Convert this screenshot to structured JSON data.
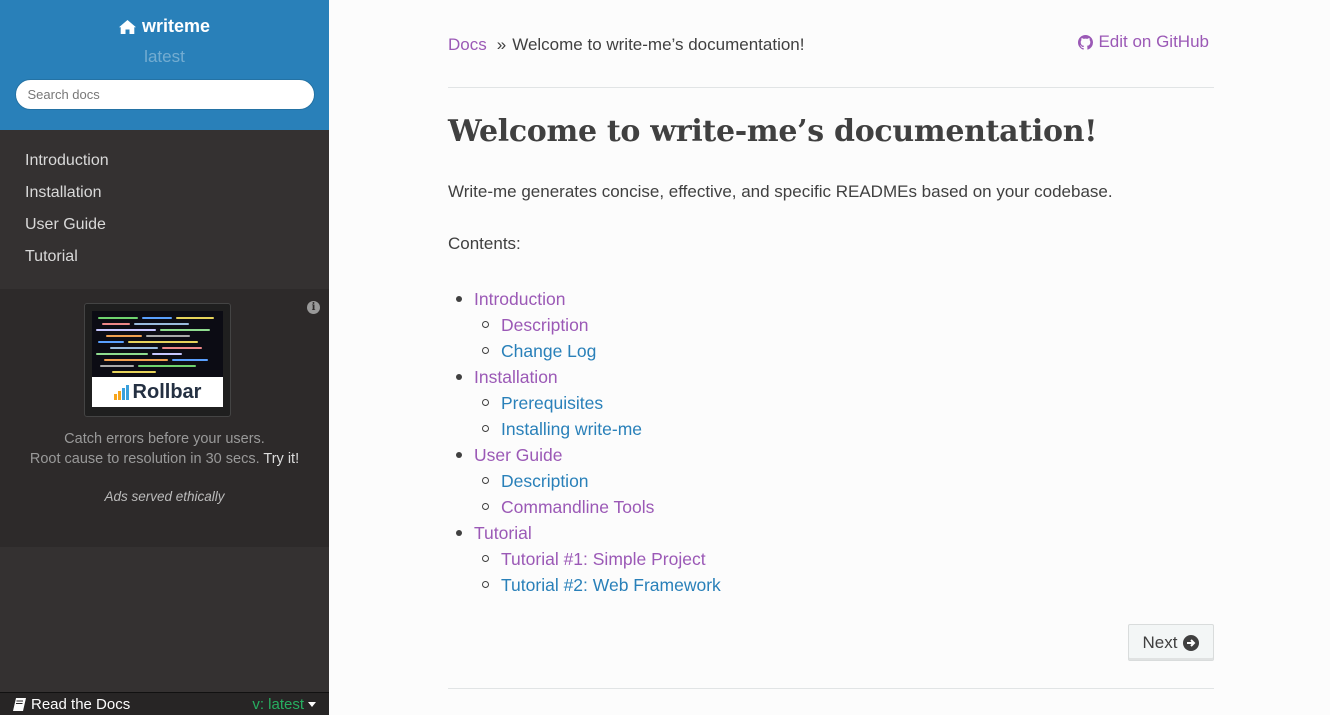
{
  "sidebar": {
    "brand": "writeme",
    "version": "latest",
    "search_placeholder": "Search docs",
    "nav": [
      "Introduction",
      "Installation",
      "User Guide",
      "Tutorial"
    ],
    "ad": {
      "logo_text": "Rollbar",
      "line1": "Catch errors before your users.",
      "line2": "Root cause to resolution in 30 secs.",
      "cta": "Try it!",
      "ethical": "Ads served ethically"
    },
    "footer": {
      "rtd_label": "Read the Docs",
      "version_label": "v: latest"
    }
  },
  "breadcrumb": {
    "root": "Docs",
    "separator": "»",
    "current": "Welcome to write-me’s documentation!",
    "edit_label": "Edit on GitHub"
  },
  "main": {
    "title": "Welcome to write-me’s documentation!",
    "intro": "Write-me generates concise, effective, and specific READMEs based on your codebase.",
    "contents_label": "Contents:",
    "toc": [
      {
        "label": "Introduction",
        "children": [
          "Description",
          "Change Log"
        ]
      },
      {
        "label": "Installation",
        "children": [
          "Prerequisites",
          "Installing write-me"
        ]
      },
      {
        "label": "User Guide",
        "children": [
          "Description",
          "Commandline Tools"
        ]
      },
      {
        "label": "Tutorial",
        "children": [
          "Tutorial #1: Simple Project",
          "Tutorial #2: Web Framework"
        ]
      }
    ],
    "next_label": "Next"
  },
  "colors": {
    "sidebar_top": "#2980b9",
    "sidebar_bg": "#343131",
    "link_visited": "#9b59b6",
    "link": "#2980b9",
    "rtd_version": "#27ae60"
  }
}
